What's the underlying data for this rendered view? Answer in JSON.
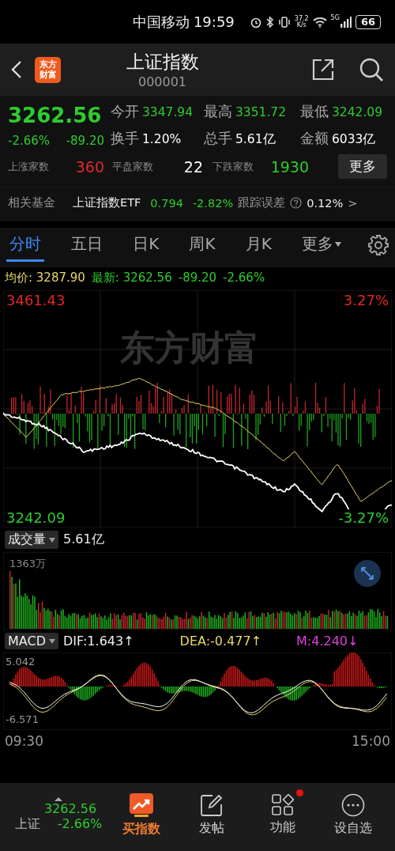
{
  "status_bar": {
    "carrier": "中国移动",
    "time": "19:59",
    "net_speed": [
      "37.2",
      "K/s"
    ],
    "network": "5G",
    "battery": "66"
  },
  "header": {
    "logo": [
      "东方",
      "财富"
    ],
    "title": "上证指数",
    "code": "000001"
  },
  "quote": {
    "price": "3262.56",
    "change_pct": "-2.66%",
    "change": "-89.20",
    "color": "#2ecc2e",
    "stats": [
      {
        "label": "今开",
        "value": "3347.94",
        "color": "#2ecc2e"
      },
      {
        "label": "最高",
        "value": "3351.72",
        "color": "#2ecc2e"
      },
      {
        "label": "最低",
        "value": "3242.09",
        "color": "#2ecc2e"
      },
      {
        "label": "换手",
        "value": "1.20%",
        "color": "#ffffff"
      },
      {
        "label": "总手",
        "value": "5.61亿",
        "color": "#ffffff"
      },
      {
        "label": "金额",
        "value": "6033亿",
        "color": "#ffffff"
      }
    ],
    "breadth": [
      {
        "label": "上涨家数",
        "value": "360",
        "color": "#e02828"
      },
      {
        "label": "平盘家数",
        "value": "22",
        "color": "#ffffff"
      },
      {
        "label": "下跌家数",
        "value": "1930",
        "color": "#2ecc2e"
      }
    ],
    "more_button": "更多"
  },
  "fund": {
    "label": "相关基金",
    "name": "上证指数ETF",
    "price": "0.794",
    "change": "-2.82%",
    "tracking_label": "跟踪误差",
    "tracking_value": "0.12%",
    "arrow": ">"
  },
  "tabs": [
    {
      "label": "分时",
      "selected": true,
      "kind": "tab"
    },
    {
      "label": "五日",
      "selected": false,
      "kind": "tab"
    },
    {
      "label": "日K",
      "selected": false,
      "kind": "tab"
    },
    {
      "label": "周K",
      "selected": false,
      "kind": "tab"
    },
    {
      "label": "月K",
      "selected": false,
      "kind": "tab"
    },
    {
      "label": "更多",
      "selected": false,
      "kind": "dropdown"
    }
  ],
  "price_chart": {
    "avg_label": "均价:",
    "avg": "3287.90",
    "latest_label": "最新:",
    "latest": "3262.56",
    "change": "-89.20",
    "change_pct": "-2.66%",
    "high": "3461.43",
    "high_pct": "3.27%",
    "low": "3242.09",
    "low_pct": "-3.27%",
    "watermark": "东方财富"
  },
  "volume": {
    "selector": "成交量",
    "total": "5.61亿",
    "max": "1363万"
  },
  "macd": {
    "selector": "MACD",
    "dif": "DIF:1.643↑",
    "dea": "DEA:-0.477↑",
    "m": "M:4.240↓",
    "max": "5.042",
    "min": "-6.571"
  },
  "time_axis": [
    "09:30",
    "15:00"
  ],
  "bottom_bar": {
    "ticker": {
      "price": "3262.56",
      "name": "上证",
      "change_pct": "-2.66%"
    },
    "items": [
      {
        "label": "买指数",
        "kind": "promo",
        "badge": false
      },
      {
        "label": "发帖",
        "kind": "post",
        "badge": false
      },
      {
        "label": "功能",
        "kind": "apps",
        "badge": true
      },
      {
        "label": "设自选",
        "kind": "more",
        "badge": false
      }
    ]
  }
}
